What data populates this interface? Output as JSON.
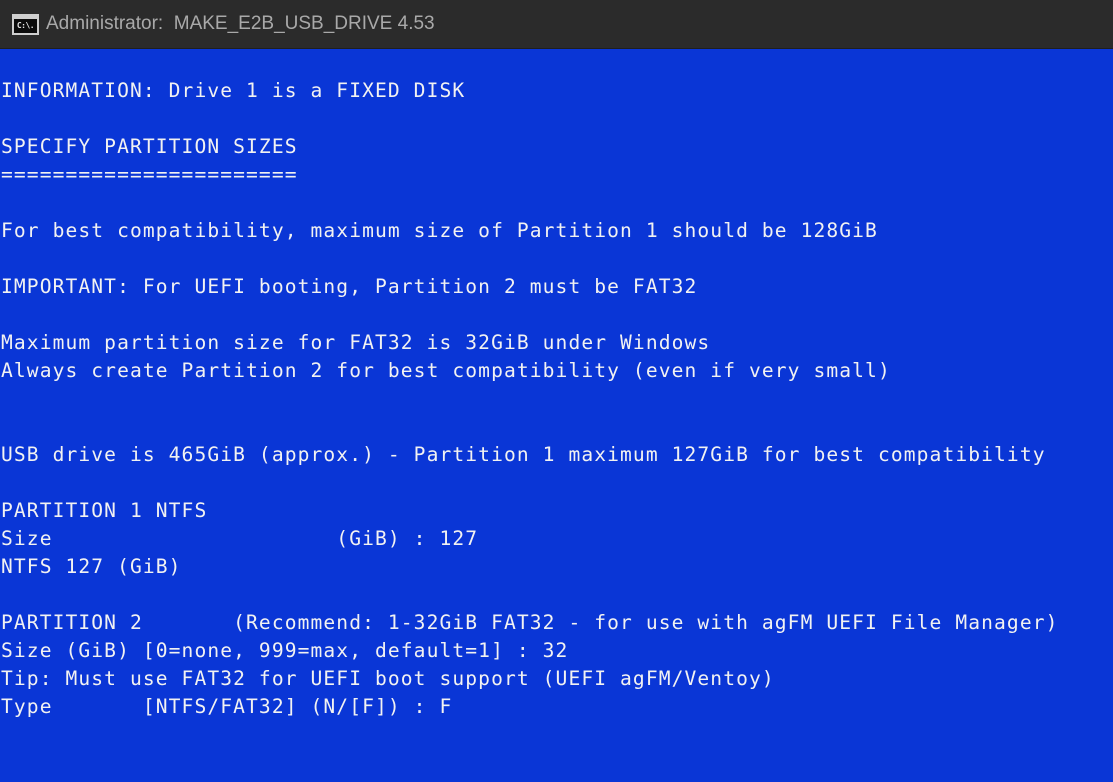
{
  "window": {
    "title": "Administrator:  MAKE_E2B_USB_DRIVE 4.53",
    "icon": "command-prompt-icon",
    "icon_glyph": "C:\\.",
    "background_color": "#0a36d6",
    "text_color": "#f2f2f2"
  },
  "console": {
    "lines": [
      "INFORMATION: Drive 1 is a FIXED DISK",
      "",
      "SPECIFY PARTITION SIZES",
      "=======================",
      "",
      "For best compatibility, maximum size of Partition 1 should be 128GiB",
      "",
      "IMPORTANT: For UEFI booting, Partition 2 must be FAT32",
      "",
      "Maximum partition size for FAT32 is 32GiB under Windows",
      "Always create Partition 2 for best compatibility (even if very small)",
      "",
      "",
      "USB drive is 465GiB (approx.) - Partition 1 maximum 127GiB for best compatibility",
      "",
      "PARTITION 1 NTFS",
      "Size                      (GiB) : 127",
      "NTFS 127 (GiB)",
      "",
      "PARTITION 2       (Recommend: 1-32GiB FAT32 - for use with agFM UEFI File Manager)",
      "Size (GiB) [0=none, 999=max, default=1] : 32",
      "Tip: Must use FAT32 for UEFI boot support (UEFI agFM/Ventoy)",
      "Type       [NTFS/FAT32] (N/[F]) : F"
    ]
  }
}
